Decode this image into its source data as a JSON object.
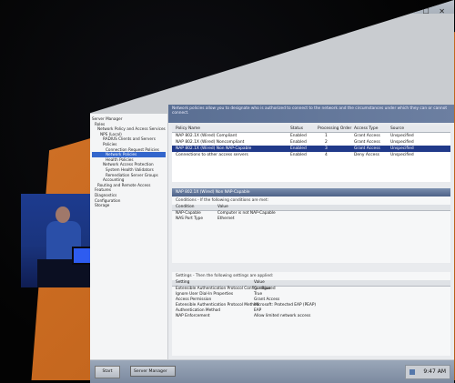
{
  "window": {
    "title_text": "Server Manager",
    "controls_glyphs": "– ☐ ✕"
  },
  "tree": {
    "items": [
      {
        "label": "Server Manager"
      },
      {
        "label": "Roles"
      },
      {
        "label": "Network Policy and Access Services"
      },
      {
        "label": "NPS (Local)"
      },
      {
        "label": "RADIUS Clients and Servers"
      },
      {
        "label": "Policies"
      },
      {
        "label": "Connection Request Policies"
      },
      {
        "label": "Network Policies",
        "selected": true
      },
      {
        "label": "Health Policies"
      },
      {
        "label": "Network Access Protection"
      },
      {
        "label": "System Health Validators"
      },
      {
        "label": "Remediation Server Groups"
      },
      {
        "label": "Accounting"
      },
      {
        "label": "Routing and Remote Access"
      },
      {
        "label": "Features"
      },
      {
        "label": "Diagnostics"
      },
      {
        "label": "Configuration"
      },
      {
        "label": "Storage"
      }
    ]
  },
  "banner": {
    "text": "Network policies allow you to designate who is authorized to connect to the network and the circumstances under which they can or cannot connect."
  },
  "policies": {
    "headers": {
      "name": "Policy Name",
      "status": "Status",
      "order": "Processing Order",
      "access": "Access Type",
      "source": "Source"
    },
    "rows": [
      {
        "name": "NAP 802.1X (Wired) Compliant",
        "status": "Enabled",
        "order": "1",
        "access": "Grant Access",
        "source": "Unspecified"
      },
      {
        "name": "NAP 802.1X (Wired) Noncompliant",
        "status": "Enabled",
        "order": "2",
        "access": "Grant Access",
        "source": "Unspecified"
      },
      {
        "name": "NAP 802.1X (Wired) Non NAP-Capable",
        "status": "Enabled",
        "order": "3",
        "access": "Grant Access",
        "source": "Unspecified",
        "selected": true
      },
      {
        "name": "Connections to other access servers",
        "status": "Enabled",
        "order": "4",
        "access": "Deny Access",
        "source": "Unspecified"
      }
    ]
  },
  "conditions": {
    "title": "NAP 802.1X (Wired) Non NAP-Capable",
    "description": "Conditions - If the following conditions are met:",
    "headers": {
      "condition": "Condition",
      "value": "Value"
    },
    "rows": [
      {
        "condition": "NAP-Capable",
        "value": "Computer is not NAP-Capable"
      },
      {
        "condition": "NAS Port Type",
        "value": "Ethernet"
      }
    ]
  },
  "settings": {
    "description": "Settings - Then the following settings are applied:",
    "headers": {
      "setting": "Setting",
      "value": "Value"
    },
    "rows": [
      {
        "setting": "Extensible Authentication Protocol Configuration",
        "value": "Configured"
      },
      {
        "setting": "Ignore User Dial-In Properties",
        "value": "True"
      },
      {
        "setting": "Access Permission",
        "value": "Grant Access"
      },
      {
        "setting": "Extensible Authentication Protocol Method",
        "value": "Microsoft: Protected EAP (PEAP)"
      },
      {
        "setting": "Authentication Method",
        "value": "EAP"
      },
      {
        "setting": "NAP Enforcement",
        "value": "Allow limited network access"
      }
    ]
  },
  "taskbar": {
    "start_label": "Start",
    "task_label": "Server Manager",
    "clock": "9:47 AM"
  },
  "colors": {
    "projection_orange": "#c96a20",
    "selection_blue": "#213a8a",
    "video_blue": "#1d3b8f"
  }
}
